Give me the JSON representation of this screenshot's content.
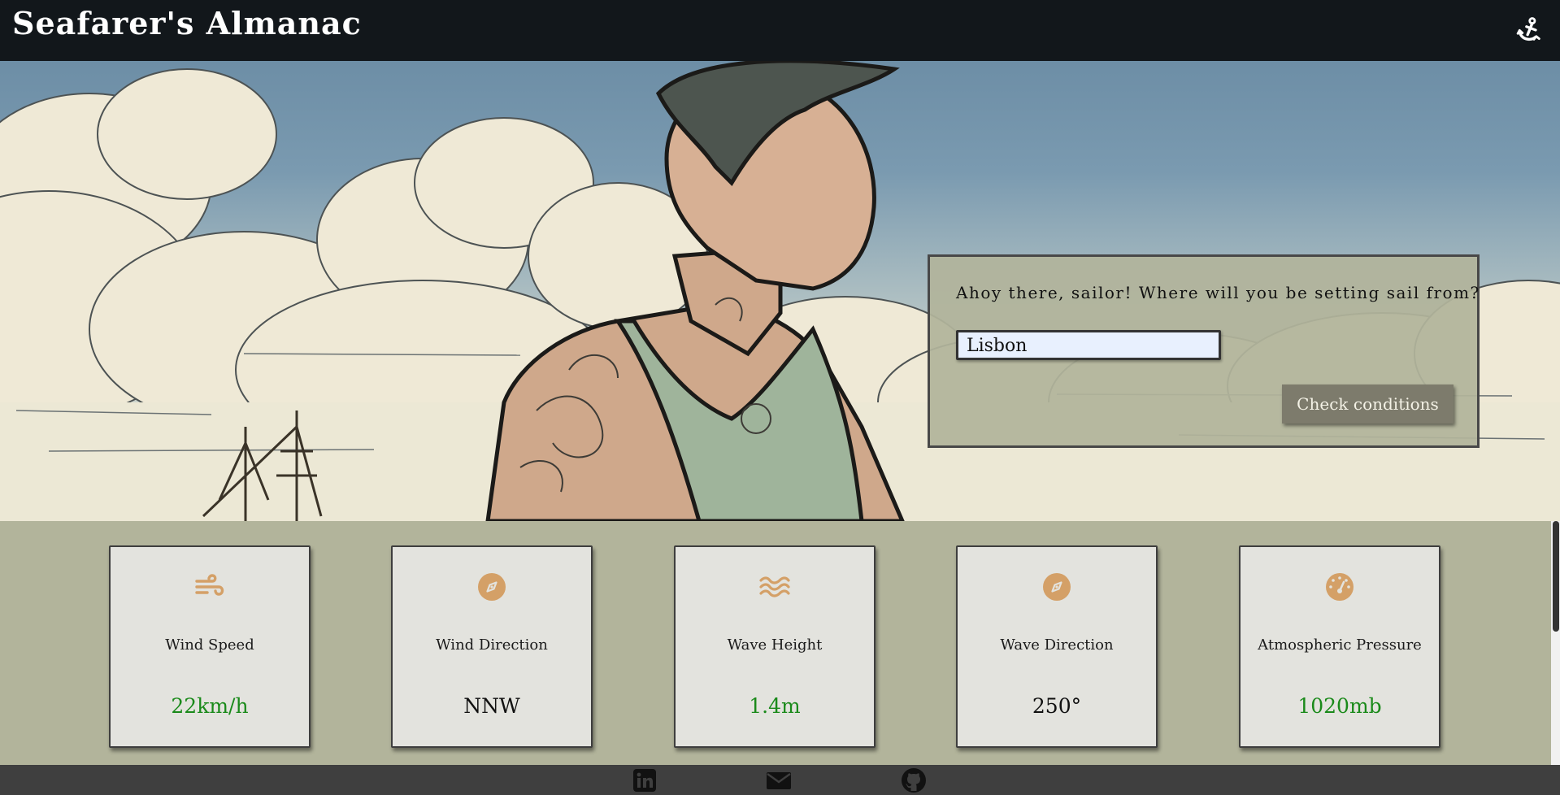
{
  "header": {
    "title": "Seafarer's Almanac",
    "anchor_icon": "anchor-icon"
  },
  "search": {
    "prompt": "Ahoy there, sailor! Where will you be setting sail from?",
    "value": "Lisbon",
    "button_label": "Check conditions"
  },
  "metrics": [
    {
      "label": "Wind Speed",
      "value": "22km/h",
      "icon": "wind-icon",
      "value_color": "#1a8a1a"
    },
    {
      "label": "Wind Direction",
      "value": "NNW",
      "icon": "compass-icon",
      "value_color": "#111111"
    },
    {
      "label": "Wave Height",
      "value": "1.4m",
      "icon": "waves-icon",
      "value_color": "#1a8a1a"
    },
    {
      "label": "Wave Direction",
      "value": "250°",
      "icon": "compass-icon",
      "value_color": "#111111"
    },
    {
      "label": "Atmospheric Pressure",
      "value": "1020mb",
      "icon": "gauge-icon",
      "value_color": "#1a8a1a"
    }
  ],
  "footer": {
    "links": [
      "linkedin-icon",
      "email-icon",
      "github-icon"
    ]
  },
  "colors": {
    "header_bg": "#12171b",
    "card_bg": "#e3e3de",
    "band_bg": "#b2b49b",
    "footer_bg": "#3f3f3f",
    "icon_accent": "#d4a067",
    "value_green": "#1a8a1a"
  }
}
